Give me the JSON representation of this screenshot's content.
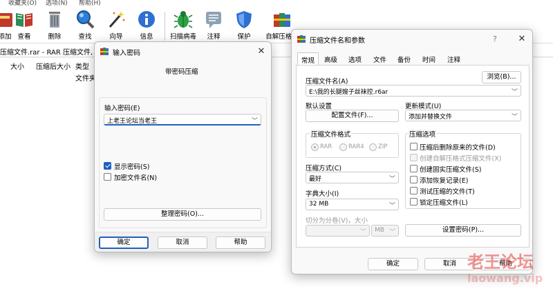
{
  "menu": {
    "items": [
      "收藏夹(O)",
      "选项(N)",
      "帮助(H)"
    ]
  },
  "toolbar": {
    "add": "添加",
    "view": "查看",
    "delete": "删除",
    "find": "查找",
    "wizard": "向导",
    "info": "信息",
    "scan": "扫描病毒",
    "comment": "注释",
    "protect": "保护",
    "sfx": "自解压格式"
  },
  "main": {
    "path": "压缩文件.rar - RAR 压缩文件, 解",
    "columns": [
      "大小",
      "压缩后大小",
      "类型"
    ],
    "type_cell": "文件夹"
  },
  "password_dialog": {
    "title": "输入密码",
    "subtitle": "带密码压缩",
    "enter_label": "输入密码(E)",
    "password_value": "上老王论坛当老王",
    "show_password": "显示密码(S)",
    "encrypt_names": "加密文件名(N)",
    "organize": "整理密码(O)...",
    "ok": "确定",
    "cancel": "取消",
    "help": "帮助"
  },
  "archive_dialog": {
    "title": "压缩文件名和参数",
    "help_glyph": "?",
    "tabs": [
      "常规",
      "高级",
      "选项",
      "文件",
      "备份",
      "时间",
      "注释"
    ],
    "archive_name_label": "压缩文件名(A)",
    "browse": "浏览(B)...",
    "archive_name_value": "E:\\我的长腿嫂子丝袜控.r6ar",
    "default_settings": "默认设置",
    "profiles": "配置文件(F)...",
    "update_mode_label": "更新模式(U)",
    "update_mode_value": "添加并替换文件",
    "format_group": "压缩文件格式",
    "formats": [
      "RAR",
      "RAR4",
      "ZIP"
    ],
    "options_group": "压缩选项",
    "options": [
      "压缩后删除原来的文件(D)",
      "创建自解压格式压缩文件(X)",
      "创建固实压缩文件(S)",
      "添加恢复记录(E)",
      "测试压缩的文件(T)",
      "锁定压缩文件(L)"
    ],
    "method_label": "压缩方式(C)",
    "method_value": "最好",
    "dict_label": "字典大小(I)",
    "dict_value": "32 MB",
    "split_label": "切分为分卷(V)，大小",
    "split_unit": "MB",
    "set_password": "设置密码(P)...",
    "ok": "确定",
    "cancel": "取消",
    "help": "帮助"
  },
  "watermark": {
    "cn": "老王论坛",
    "url": "laowang.vip"
  }
}
